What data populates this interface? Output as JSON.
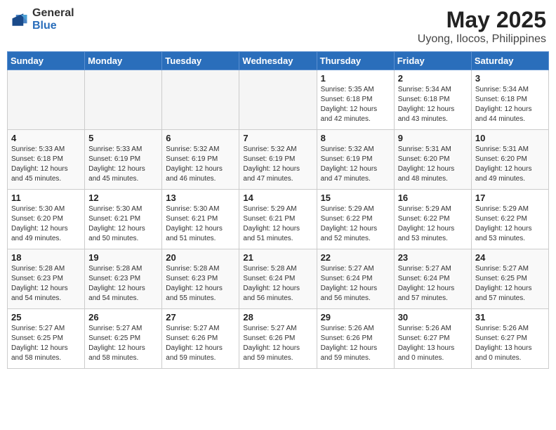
{
  "header": {
    "logo_general": "General",
    "logo_blue": "Blue",
    "month_year": "May 2025",
    "location": "Uyong, Ilocos, Philippines"
  },
  "weekdays": [
    "Sunday",
    "Monday",
    "Tuesday",
    "Wednesday",
    "Thursday",
    "Friday",
    "Saturday"
  ],
  "weeks": [
    [
      {
        "day": "",
        "info": ""
      },
      {
        "day": "",
        "info": ""
      },
      {
        "day": "",
        "info": ""
      },
      {
        "day": "",
        "info": ""
      },
      {
        "day": "1",
        "info": "Sunrise: 5:35 AM\nSunset: 6:18 PM\nDaylight: 12 hours\nand 42 minutes."
      },
      {
        "day": "2",
        "info": "Sunrise: 5:34 AM\nSunset: 6:18 PM\nDaylight: 12 hours\nand 43 minutes."
      },
      {
        "day": "3",
        "info": "Sunrise: 5:34 AM\nSunset: 6:18 PM\nDaylight: 12 hours\nand 44 minutes."
      }
    ],
    [
      {
        "day": "4",
        "info": "Sunrise: 5:33 AM\nSunset: 6:18 PM\nDaylight: 12 hours\nand 45 minutes."
      },
      {
        "day": "5",
        "info": "Sunrise: 5:33 AM\nSunset: 6:19 PM\nDaylight: 12 hours\nand 45 minutes."
      },
      {
        "day": "6",
        "info": "Sunrise: 5:32 AM\nSunset: 6:19 PM\nDaylight: 12 hours\nand 46 minutes."
      },
      {
        "day": "7",
        "info": "Sunrise: 5:32 AM\nSunset: 6:19 PM\nDaylight: 12 hours\nand 47 minutes."
      },
      {
        "day": "8",
        "info": "Sunrise: 5:32 AM\nSunset: 6:19 PM\nDaylight: 12 hours\nand 47 minutes."
      },
      {
        "day": "9",
        "info": "Sunrise: 5:31 AM\nSunset: 6:20 PM\nDaylight: 12 hours\nand 48 minutes."
      },
      {
        "day": "10",
        "info": "Sunrise: 5:31 AM\nSunset: 6:20 PM\nDaylight: 12 hours\nand 49 minutes."
      }
    ],
    [
      {
        "day": "11",
        "info": "Sunrise: 5:30 AM\nSunset: 6:20 PM\nDaylight: 12 hours\nand 49 minutes."
      },
      {
        "day": "12",
        "info": "Sunrise: 5:30 AM\nSunset: 6:21 PM\nDaylight: 12 hours\nand 50 minutes."
      },
      {
        "day": "13",
        "info": "Sunrise: 5:30 AM\nSunset: 6:21 PM\nDaylight: 12 hours\nand 51 minutes."
      },
      {
        "day": "14",
        "info": "Sunrise: 5:29 AM\nSunset: 6:21 PM\nDaylight: 12 hours\nand 51 minutes."
      },
      {
        "day": "15",
        "info": "Sunrise: 5:29 AM\nSunset: 6:22 PM\nDaylight: 12 hours\nand 52 minutes."
      },
      {
        "day": "16",
        "info": "Sunrise: 5:29 AM\nSunset: 6:22 PM\nDaylight: 12 hours\nand 53 minutes."
      },
      {
        "day": "17",
        "info": "Sunrise: 5:29 AM\nSunset: 6:22 PM\nDaylight: 12 hours\nand 53 minutes."
      }
    ],
    [
      {
        "day": "18",
        "info": "Sunrise: 5:28 AM\nSunset: 6:23 PM\nDaylight: 12 hours\nand 54 minutes."
      },
      {
        "day": "19",
        "info": "Sunrise: 5:28 AM\nSunset: 6:23 PM\nDaylight: 12 hours\nand 54 minutes."
      },
      {
        "day": "20",
        "info": "Sunrise: 5:28 AM\nSunset: 6:23 PM\nDaylight: 12 hours\nand 55 minutes."
      },
      {
        "day": "21",
        "info": "Sunrise: 5:28 AM\nSunset: 6:24 PM\nDaylight: 12 hours\nand 56 minutes."
      },
      {
        "day": "22",
        "info": "Sunrise: 5:27 AM\nSunset: 6:24 PM\nDaylight: 12 hours\nand 56 minutes."
      },
      {
        "day": "23",
        "info": "Sunrise: 5:27 AM\nSunset: 6:24 PM\nDaylight: 12 hours\nand 57 minutes."
      },
      {
        "day": "24",
        "info": "Sunrise: 5:27 AM\nSunset: 6:25 PM\nDaylight: 12 hours\nand 57 minutes."
      }
    ],
    [
      {
        "day": "25",
        "info": "Sunrise: 5:27 AM\nSunset: 6:25 PM\nDaylight: 12 hours\nand 58 minutes."
      },
      {
        "day": "26",
        "info": "Sunrise: 5:27 AM\nSunset: 6:25 PM\nDaylight: 12 hours\nand 58 minutes."
      },
      {
        "day": "27",
        "info": "Sunrise: 5:27 AM\nSunset: 6:26 PM\nDaylight: 12 hours\nand 59 minutes."
      },
      {
        "day": "28",
        "info": "Sunrise: 5:27 AM\nSunset: 6:26 PM\nDaylight: 12 hours\nand 59 minutes."
      },
      {
        "day": "29",
        "info": "Sunrise: 5:26 AM\nSunset: 6:26 PM\nDaylight: 12 hours\nand 59 minutes."
      },
      {
        "day": "30",
        "info": "Sunrise: 5:26 AM\nSunset: 6:27 PM\nDaylight: 13 hours\nand 0 minutes."
      },
      {
        "day": "31",
        "info": "Sunrise: 5:26 AM\nSunset: 6:27 PM\nDaylight: 13 hours\nand 0 minutes."
      }
    ]
  ]
}
